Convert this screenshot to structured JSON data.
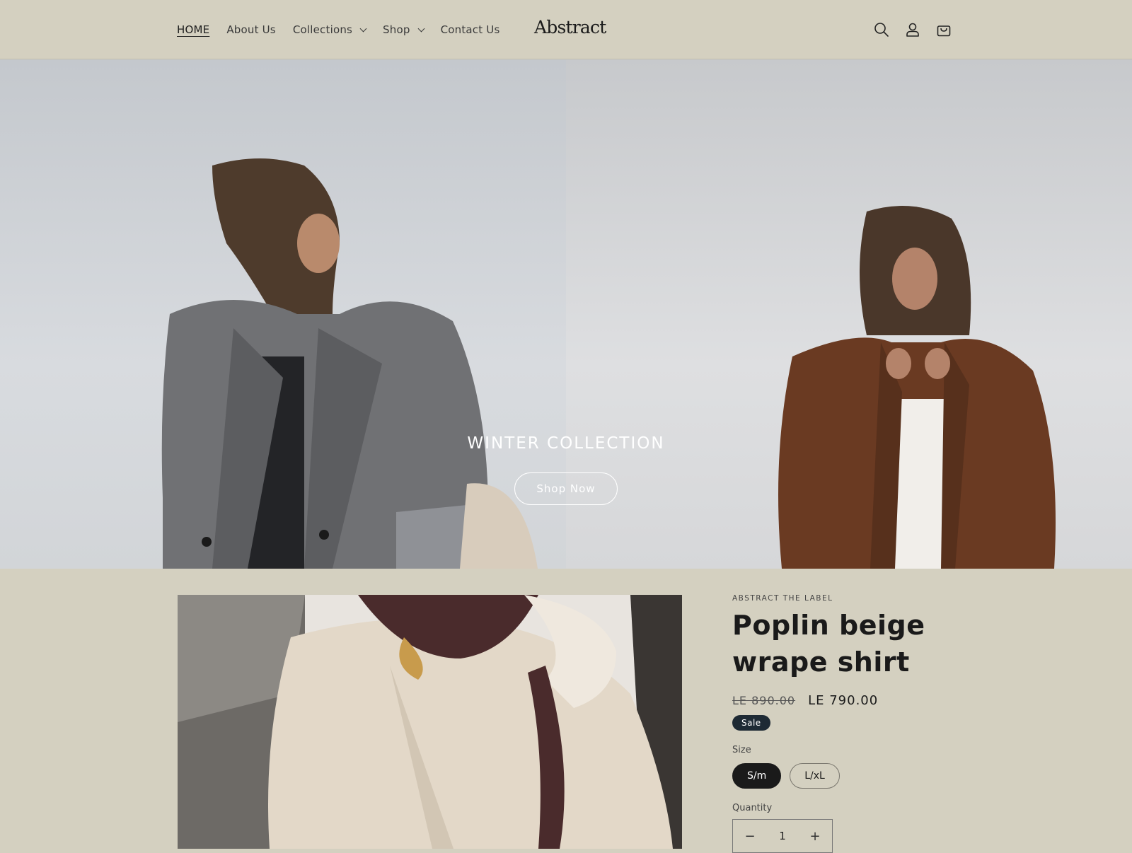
{
  "nav": {
    "items": [
      {
        "label": "HOME",
        "dropdown": false,
        "active": true
      },
      {
        "label": "About Us",
        "dropdown": false,
        "active": false
      },
      {
        "label": "Collections",
        "dropdown": true,
        "active": false
      },
      {
        "label": "Shop",
        "dropdown": true,
        "active": false
      },
      {
        "label": "Contact Us",
        "dropdown": false,
        "active": false
      }
    ]
  },
  "brand": {
    "logo": "Abstract"
  },
  "header_icons": [
    "search-icon",
    "account-icon",
    "cart-icon"
  ],
  "hero": {
    "title": "WINTER COLLECTION",
    "button_label": "Shop Now"
  },
  "product": {
    "vendor": "ABSTRACT THE LABEL",
    "title_line1": "Poplin beige",
    "title_line2": "wrape shirt",
    "price_original": "LE 890.00",
    "price_sale": "LE 790.00",
    "badge": "Sale",
    "size_label": "Size",
    "sizes": [
      "S/m",
      "L/xL"
    ],
    "selected_size": "S/m",
    "quantity_label": "Quantity",
    "quantity": "1",
    "qty_minus": "−",
    "qty_plus": "+"
  },
  "colors": {
    "page_bg": "#d4d0c0",
    "text": "#1a1a1a",
    "badge_bg": "#1e2a34"
  }
}
